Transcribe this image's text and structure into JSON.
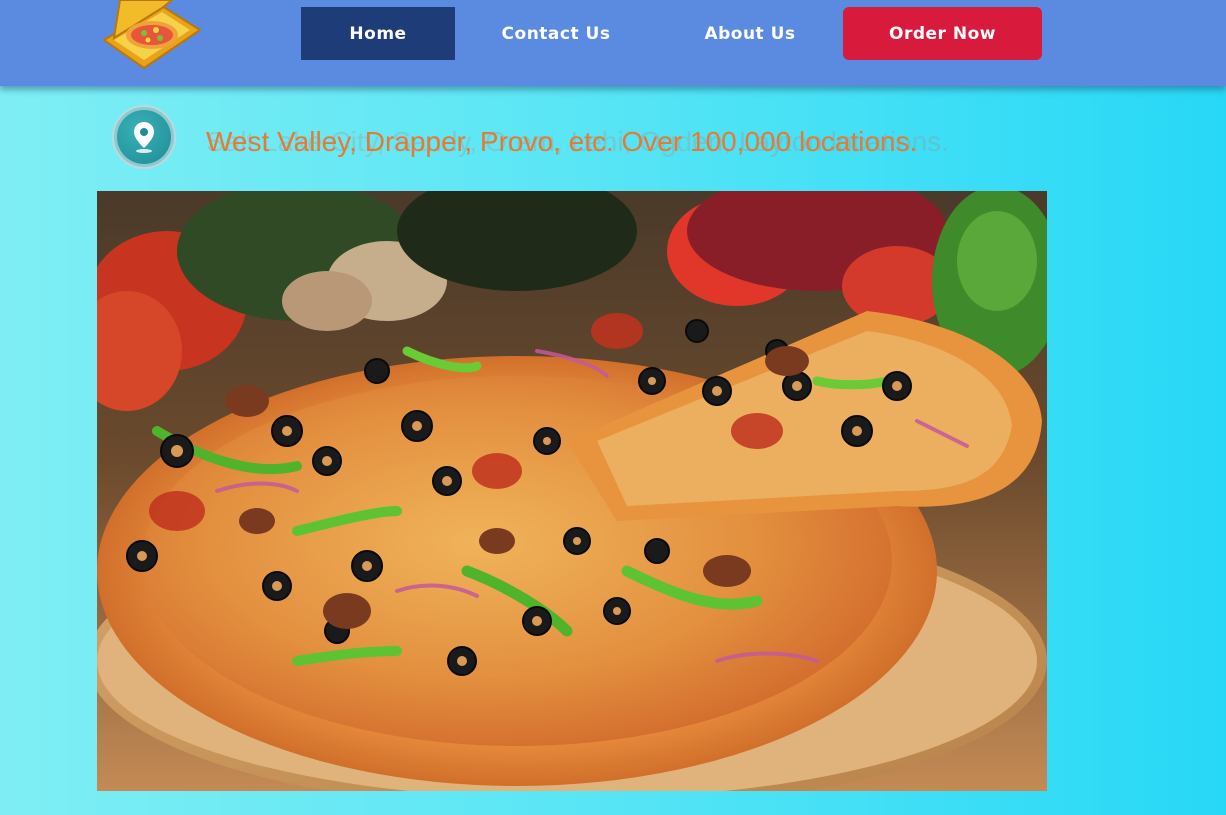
{
  "header": {
    "logo_icon": "pizza-box-icon",
    "nav": {
      "home_label": "Home",
      "contact_label": "Contact Us",
      "about_label": "About Us",
      "order_label": "Order Now"
    },
    "colors": {
      "bar": "#5a8be0",
      "active": "#1e3c78",
      "order": "#d81a3c"
    }
  },
  "location": {
    "icon": "location-pin-icon",
    "text": "West Valley, Drapper, Provo, etc. Over 100,000 locations.",
    "ghost_text": "Salt Lake City, Sandy, Orem, Lehi, Ogden, Layton locations.",
    "color": "#e67a35"
  },
  "hero": {
    "image": "pizza-hero-photo"
  }
}
